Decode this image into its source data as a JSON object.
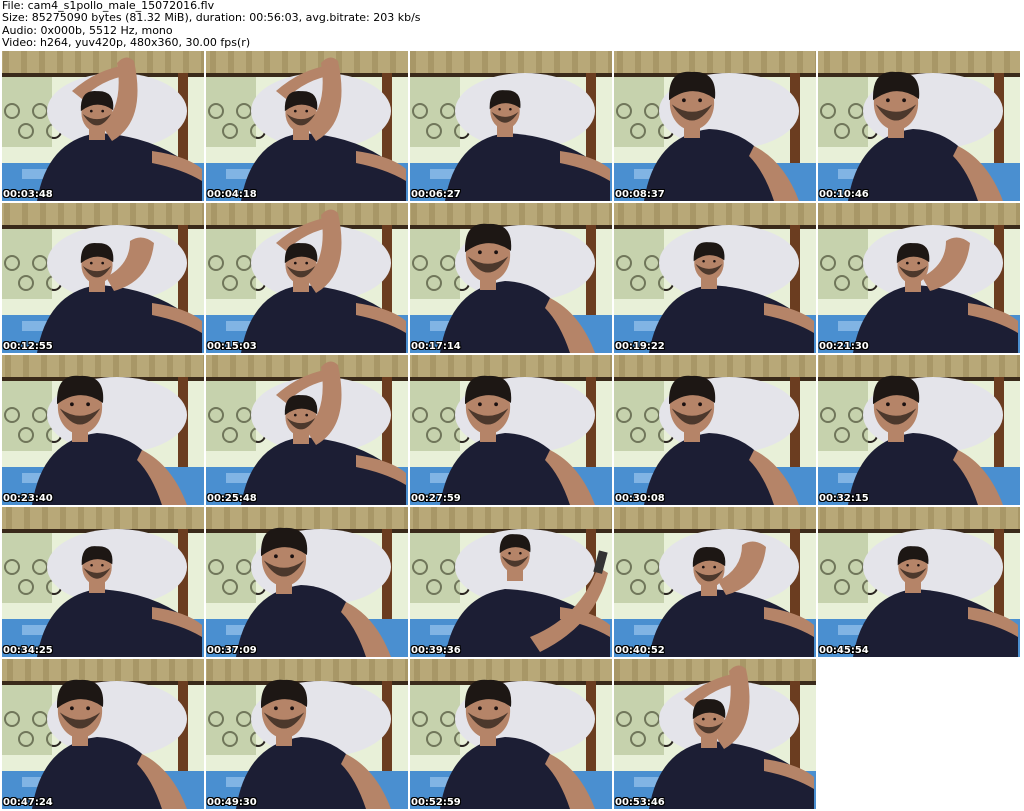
{
  "header": {
    "file": "File: cam4_s1pollo_male_15072016.flv",
    "size": "Size: 85275090 bytes (81.32 MiB), duration: 00:56:03, avg.bitrate: 203 kb/s",
    "audio": "Audio: 0x000b, 5512 Hz, mono",
    "video": "Video: h264, yuv420p, 480x360, 30.00 fps(r)"
  },
  "thumbnails": [
    {
      "timestamp": "00:03:48",
      "pose": "arm-up"
    },
    {
      "timestamp": "00:04:18",
      "pose": "arm-up"
    },
    {
      "timestamp": "00:06:27",
      "pose": "lying"
    },
    {
      "timestamp": "00:08:37",
      "pose": "close"
    },
    {
      "timestamp": "00:10:46",
      "pose": "close"
    },
    {
      "timestamp": "00:12:55",
      "pose": "hand-head"
    },
    {
      "timestamp": "00:15:03",
      "pose": "arm-up"
    },
    {
      "timestamp": "00:17:14",
      "pose": "close"
    },
    {
      "timestamp": "00:19:22",
      "pose": "lying"
    },
    {
      "timestamp": "00:21:30",
      "pose": "hand-head"
    },
    {
      "timestamp": "00:23:40",
      "pose": "close"
    },
    {
      "timestamp": "00:25:48",
      "pose": "arm-up"
    },
    {
      "timestamp": "00:27:59",
      "pose": "close"
    },
    {
      "timestamp": "00:30:08",
      "pose": "close"
    },
    {
      "timestamp": "00:32:15",
      "pose": "close"
    },
    {
      "timestamp": "00:34:25",
      "pose": "lying"
    },
    {
      "timestamp": "00:37:09",
      "pose": "close"
    },
    {
      "timestamp": "00:39:36",
      "pose": "phone"
    },
    {
      "timestamp": "00:40:52",
      "pose": "hand-head"
    },
    {
      "timestamp": "00:45:54",
      "pose": "lying"
    },
    {
      "timestamp": "00:47:24",
      "pose": "close"
    },
    {
      "timestamp": "00:49:30",
      "pose": "close"
    },
    {
      "timestamp": "00:52:59",
      "pose": "close"
    },
    {
      "timestamp": "00:53:46",
      "pose": "arm-up"
    }
  ],
  "colors": {
    "background": "#ffffff",
    "header_text": "#000000",
    "timestamp_text": "#ffffff",
    "timestamp_outline": "#000000",
    "shirt": "#1c1e34",
    "skin": "#b58468",
    "hair": "#1d1714",
    "pillow": "#e4e4ea",
    "curtain": "#b8a878",
    "window": "#e8f0d8",
    "blanket": "#4a8fd0"
  }
}
